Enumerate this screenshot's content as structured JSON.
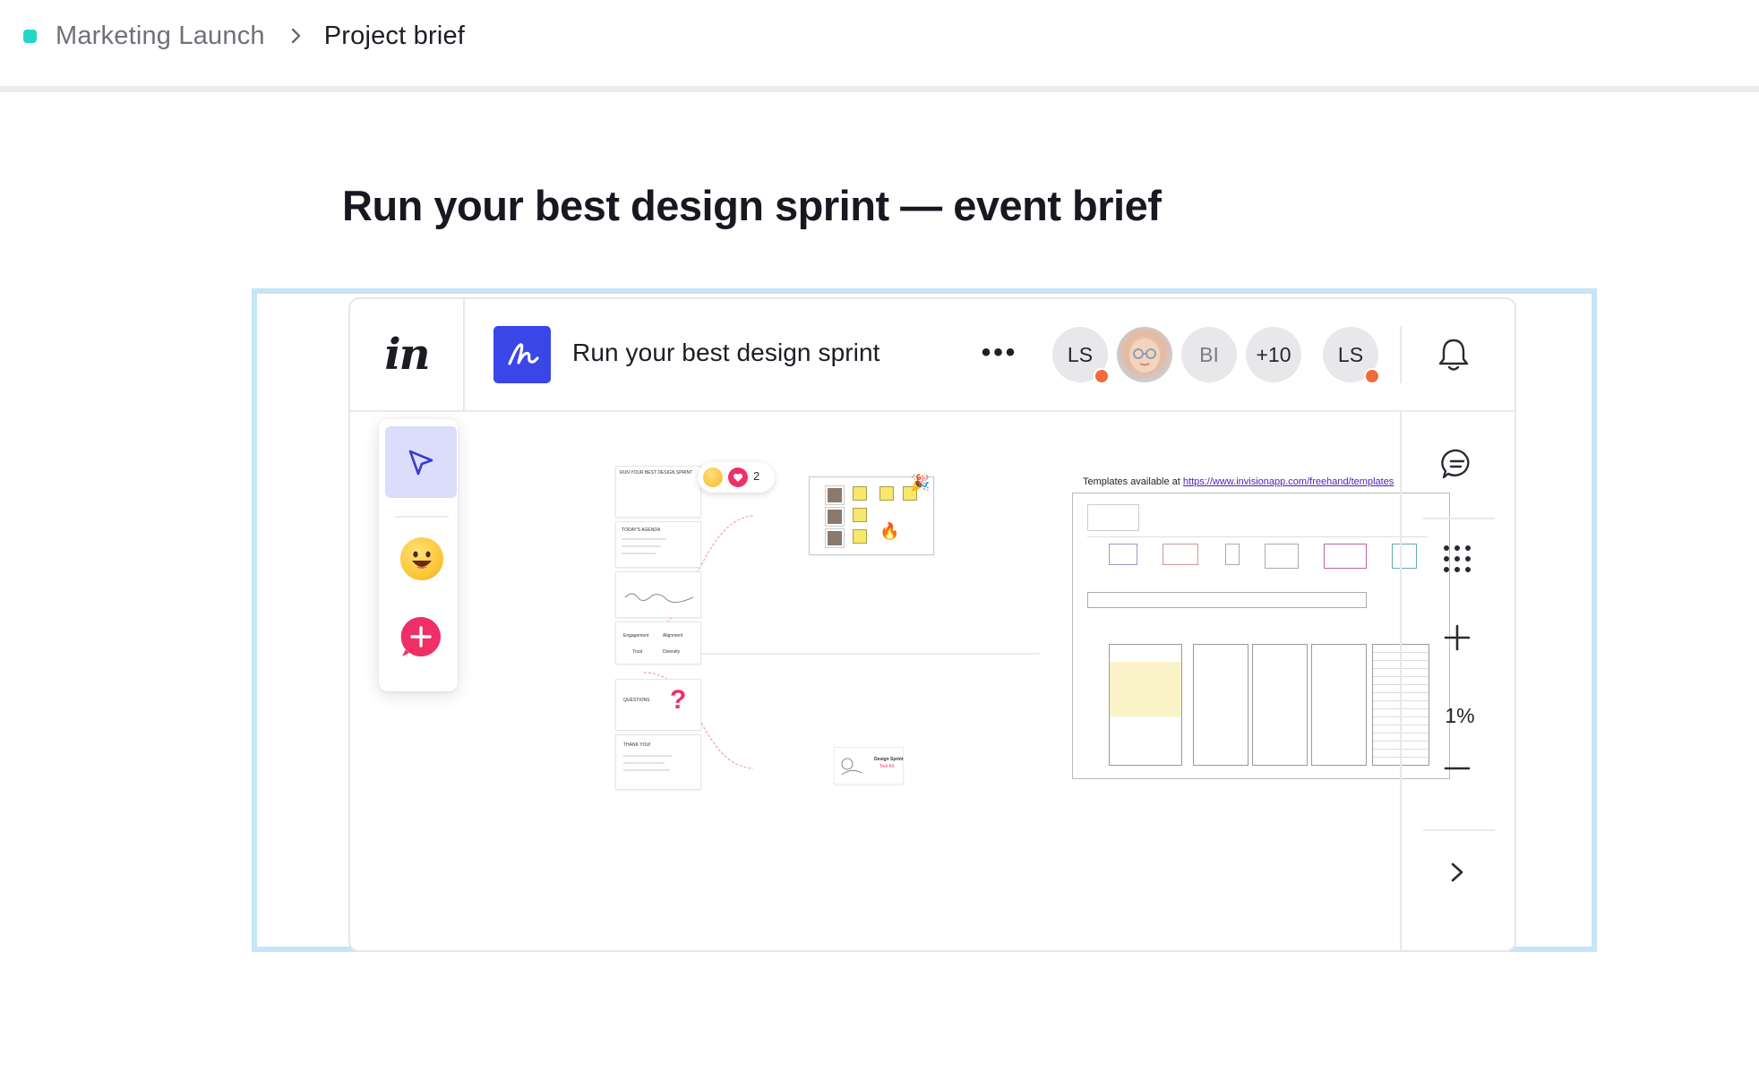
{
  "breadcrumb": {
    "project_color": "#25d6c6",
    "parent": "Marketing Launch",
    "current": "Project brief"
  },
  "document": {
    "title": "Run your best design sprint — event brief"
  },
  "embed": {
    "app_logo": "in",
    "board_title": "Run your best design sprint",
    "more_icon": "•••",
    "collaborators": [
      {
        "initials": "LS",
        "online": true
      },
      {
        "initials": "",
        "photo": true
      },
      {
        "initials": "BI",
        "online": false
      },
      {
        "initials": "+10"
      },
      {
        "initials": "LS",
        "online": true
      }
    ],
    "zoom_level": "1%",
    "canvas": {
      "reaction_count": "2",
      "slide_texts": {
        "cover": "RUN YOUR BEST DESIGN SPRINT",
        "agenda": "TODAY'S AGENDA",
        "engagement": "Engagement",
        "alignment": "Alignment",
        "trust": "Trust",
        "diversity": "Diversity",
        "questions": "QUESTIONS",
        "thank_you": "THANK YOU!",
        "sprint_kit": "Design Sprint",
        "sprint_kit_sub": "Tool Kit"
      },
      "templates_prefix": "Templates available at",
      "templates_url": "https://www.invisionapp.com/freehand/templates"
    },
    "colors": {
      "accent": "#3a46e8",
      "selected_tool_bg": "#dcdcfb",
      "status_dot": "#f26b3a",
      "embed_border": "#c6e5f6",
      "add_button": "#ef2f66"
    }
  }
}
